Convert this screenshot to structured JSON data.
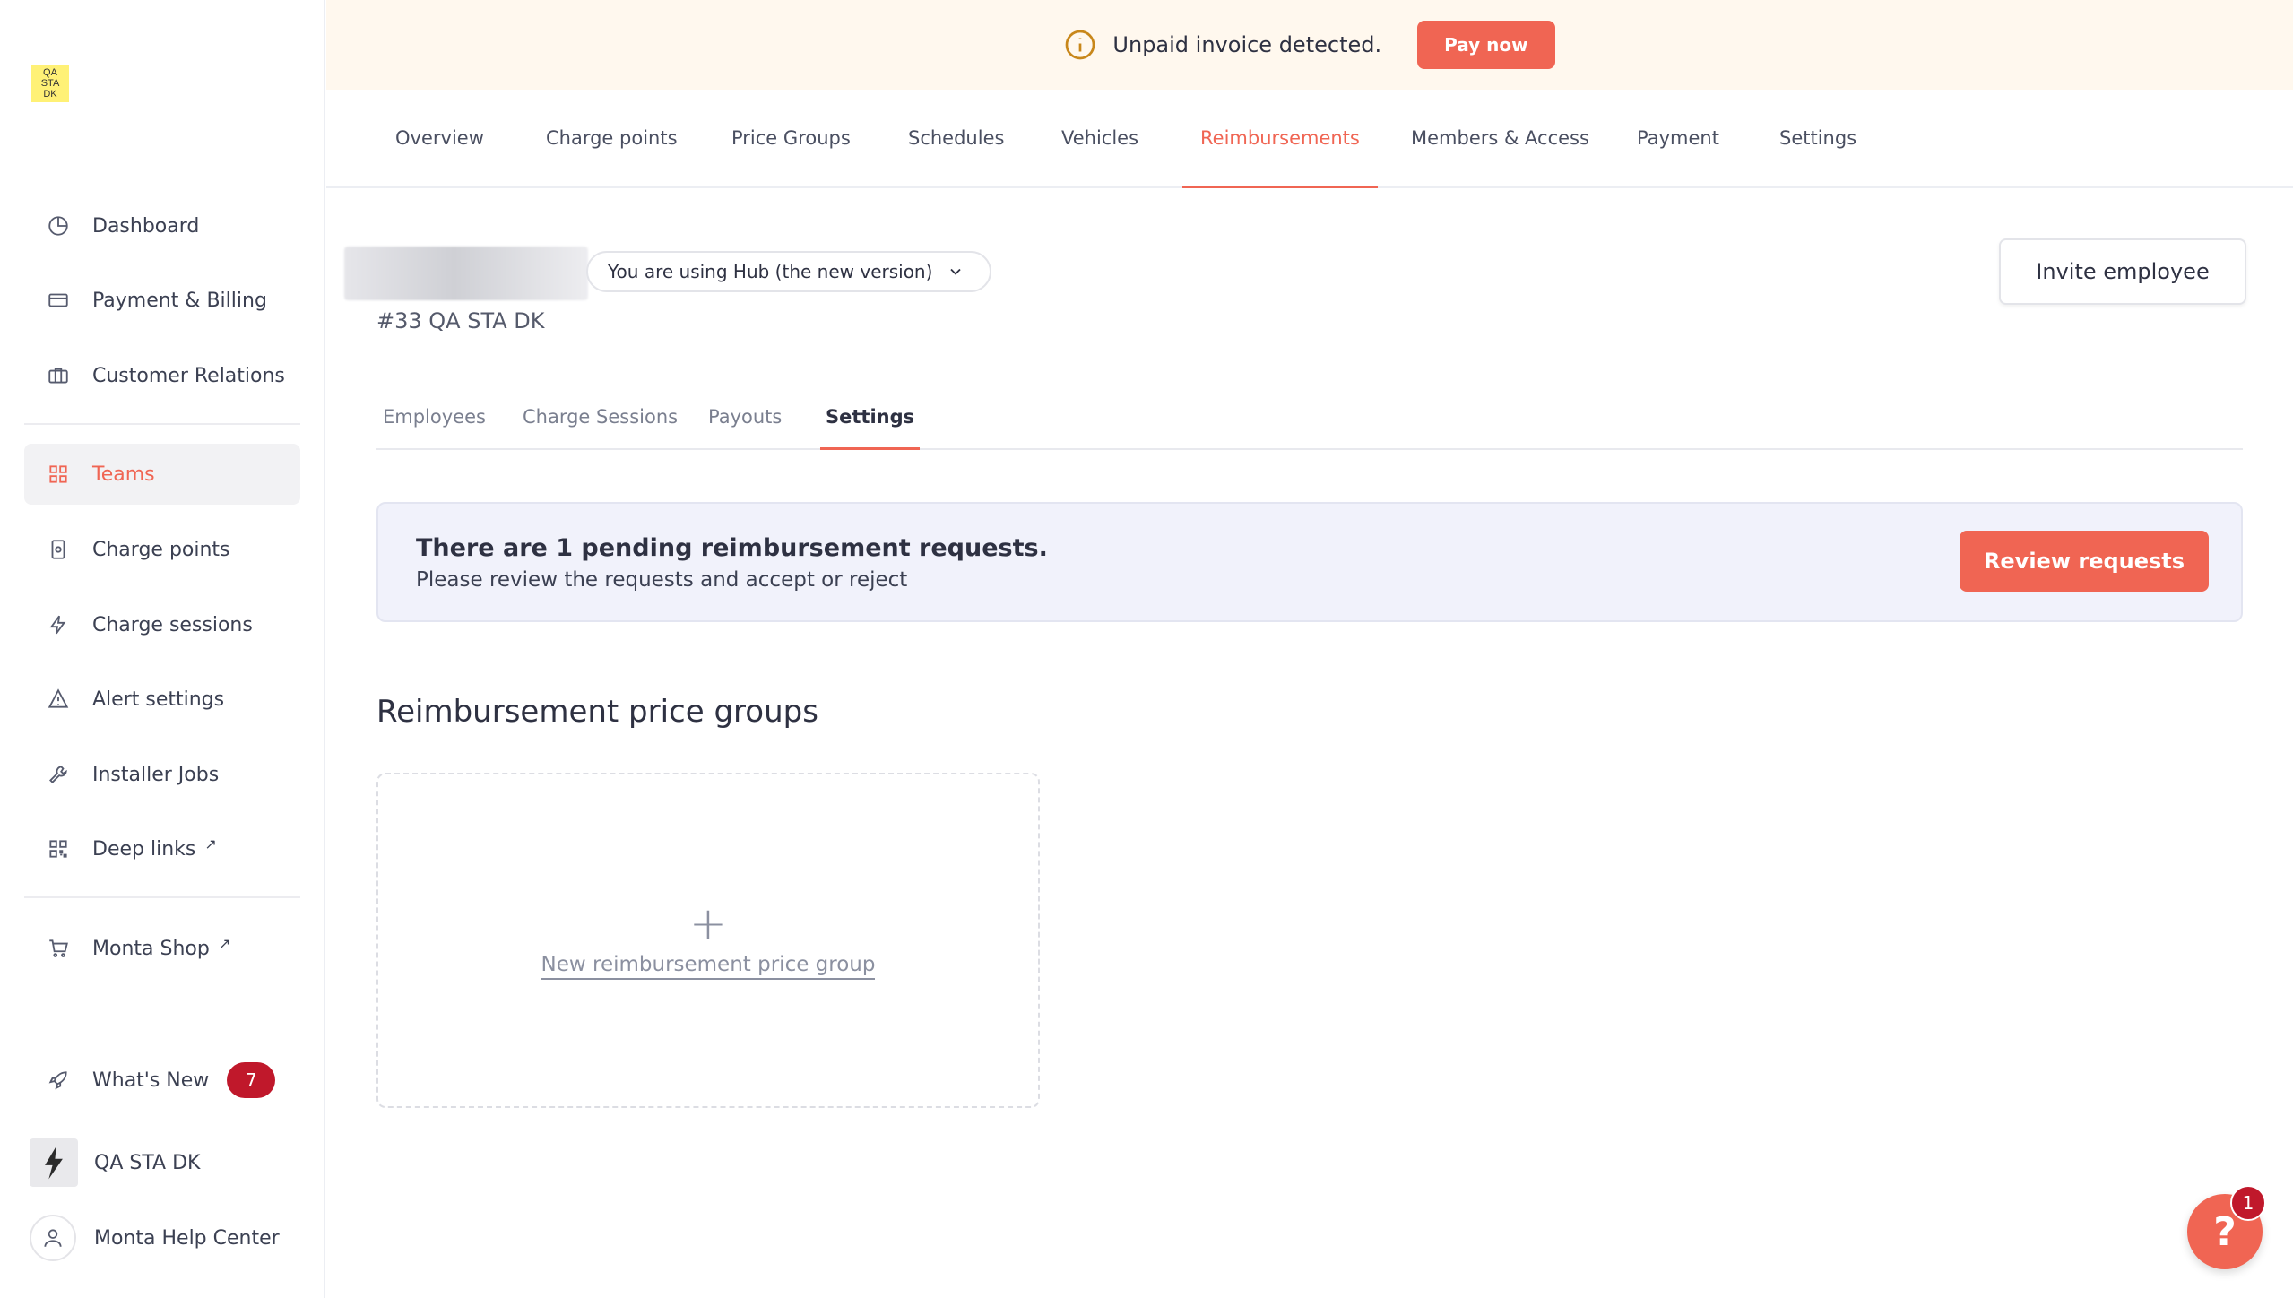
{
  "sidebar": {
    "logo_text": "QA STA DK",
    "items": [
      {
        "label": "Dashboard",
        "icon": "pie-chart-icon"
      },
      {
        "label": "Payment & Billing",
        "icon": "credit-card-icon"
      },
      {
        "label": "Customer Relations",
        "icon": "briefcase-icon"
      },
      {
        "label": "Teams",
        "icon": "grid-icon",
        "active": true
      },
      {
        "label": "Charge points",
        "icon": "charger-icon"
      },
      {
        "label": "Charge sessions",
        "icon": "lightning-icon"
      },
      {
        "label": "Alert settings",
        "icon": "alert-bell-icon"
      },
      {
        "label": "Installer Jobs",
        "icon": "wrench-icon"
      },
      {
        "label": "Deep links",
        "icon": "qr-code-icon",
        "external": true
      },
      {
        "label": "Monta Shop",
        "icon": "cart-icon",
        "external": true
      }
    ],
    "external_glyph": "↗",
    "whats_new": {
      "label": "What's New",
      "badge": "7"
    },
    "org": {
      "label": "QA STA DK"
    },
    "help_center": {
      "label": "Monta Help Center"
    }
  },
  "banner": {
    "message": "Unpaid invoice detected.",
    "button": "Pay now"
  },
  "topnav": {
    "tabs": [
      "Overview",
      "Charge points",
      "Price Groups",
      "Schedules",
      "Vehicles",
      "Reimbursements",
      "Members & Access",
      "Payment",
      "Settings"
    ],
    "active": "Reimbursements"
  },
  "header": {
    "hub_version": "You are using Hub (the new version)",
    "org_id": "#33 QA STA DK",
    "invite_button": "Invite employee"
  },
  "subtabs": {
    "tabs": [
      "Employees",
      "Charge Sessions",
      "Payouts",
      "Settings"
    ],
    "active": "Settings"
  },
  "pending": {
    "title": "There are 1 pending reimbursement requests.",
    "description": "Please review the requests and accept or reject",
    "button": "Review requests"
  },
  "price_groups": {
    "title": "Reimbursement price groups",
    "plus": "+",
    "new_label": "New reimbursement price group"
  },
  "help": {
    "glyph": "?",
    "badge": "1"
  },
  "colors": {
    "accent": "#f06553",
    "badge": "#c0182b",
    "banner_bg": "#fff8ee",
    "pending_bg": "#f1f2fb"
  }
}
